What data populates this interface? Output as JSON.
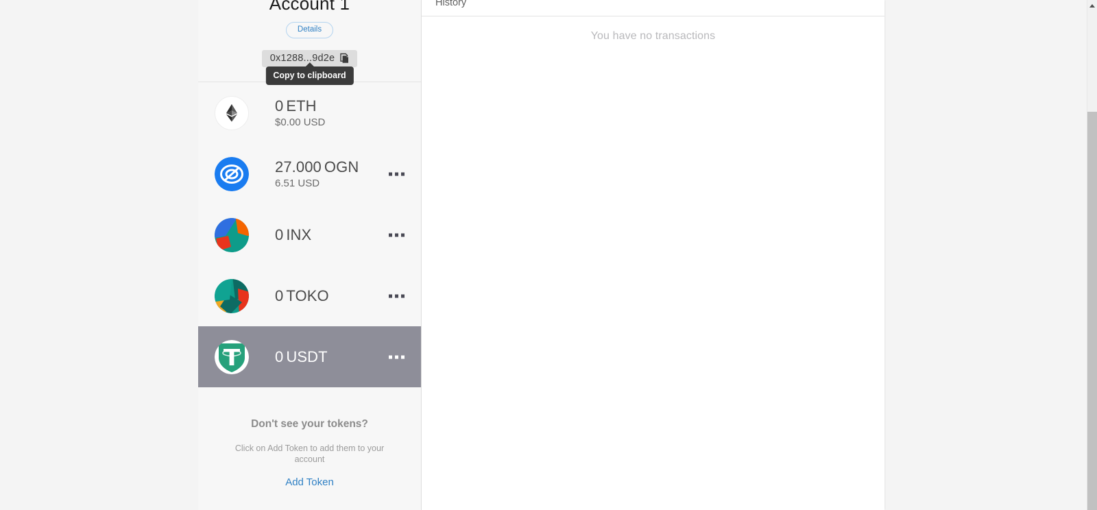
{
  "account": {
    "name": "Account 1",
    "details_label": "Details",
    "address": "0x1288...9d2e",
    "copy_icon": "copy-to-clipboard-icon",
    "tooltip": "Copy to clipboard"
  },
  "tokens": [
    {
      "icon": "ethereum-logo-icon",
      "amount": "0",
      "symbol": "ETH",
      "fiat": "$0.00 USD",
      "has_menu": false,
      "selected": false
    },
    {
      "icon": "origin-protocol-logo-icon",
      "amount": "27.000",
      "symbol": "OGN",
      "fiat": "6.51 USD",
      "has_menu": true,
      "selected": false,
      "menu_icon": "more-options-icon"
    },
    {
      "icon": "inx-token-identicon",
      "amount": "0",
      "symbol": "INX",
      "fiat": "",
      "has_menu": true,
      "selected": false,
      "menu_icon": "more-options-icon"
    },
    {
      "icon": "toko-token-identicon",
      "amount": "0",
      "symbol": "TOKO",
      "fiat": "",
      "has_menu": true,
      "selected": false,
      "menu_icon": "more-options-icon"
    },
    {
      "icon": "tether-usdt-logo-icon",
      "amount": "0",
      "symbol": "USDT",
      "fiat": "",
      "has_menu": true,
      "selected": true,
      "menu_icon": "more-options-icon"
    }
  ],
  "add_token": {
    "title": "Don't see your tokens?",
    "description": "Click on Add Token to add them to your account",
    "link": "Add Token"
  },
  "history": {
    "tab_label": "History",
    "empty_message": "You have no transactions"
  },
  "colors": {
    "accent_link": "#2f80c4",
    "selected_row_bg": "#8e8e99",
    "tooltip_bg": "#3b3b3b",
    "address_pill_bg": "#dddddd",
    "ogn_blue": "#1a7cf0",
    "tether_green": "#26a17b"
  },
  "scrollbar": {
    "up_arrow_icon": "scroll-up-arrow-icon",
    "thumb": "vertical-scrollbar-thumb"
  }
}
